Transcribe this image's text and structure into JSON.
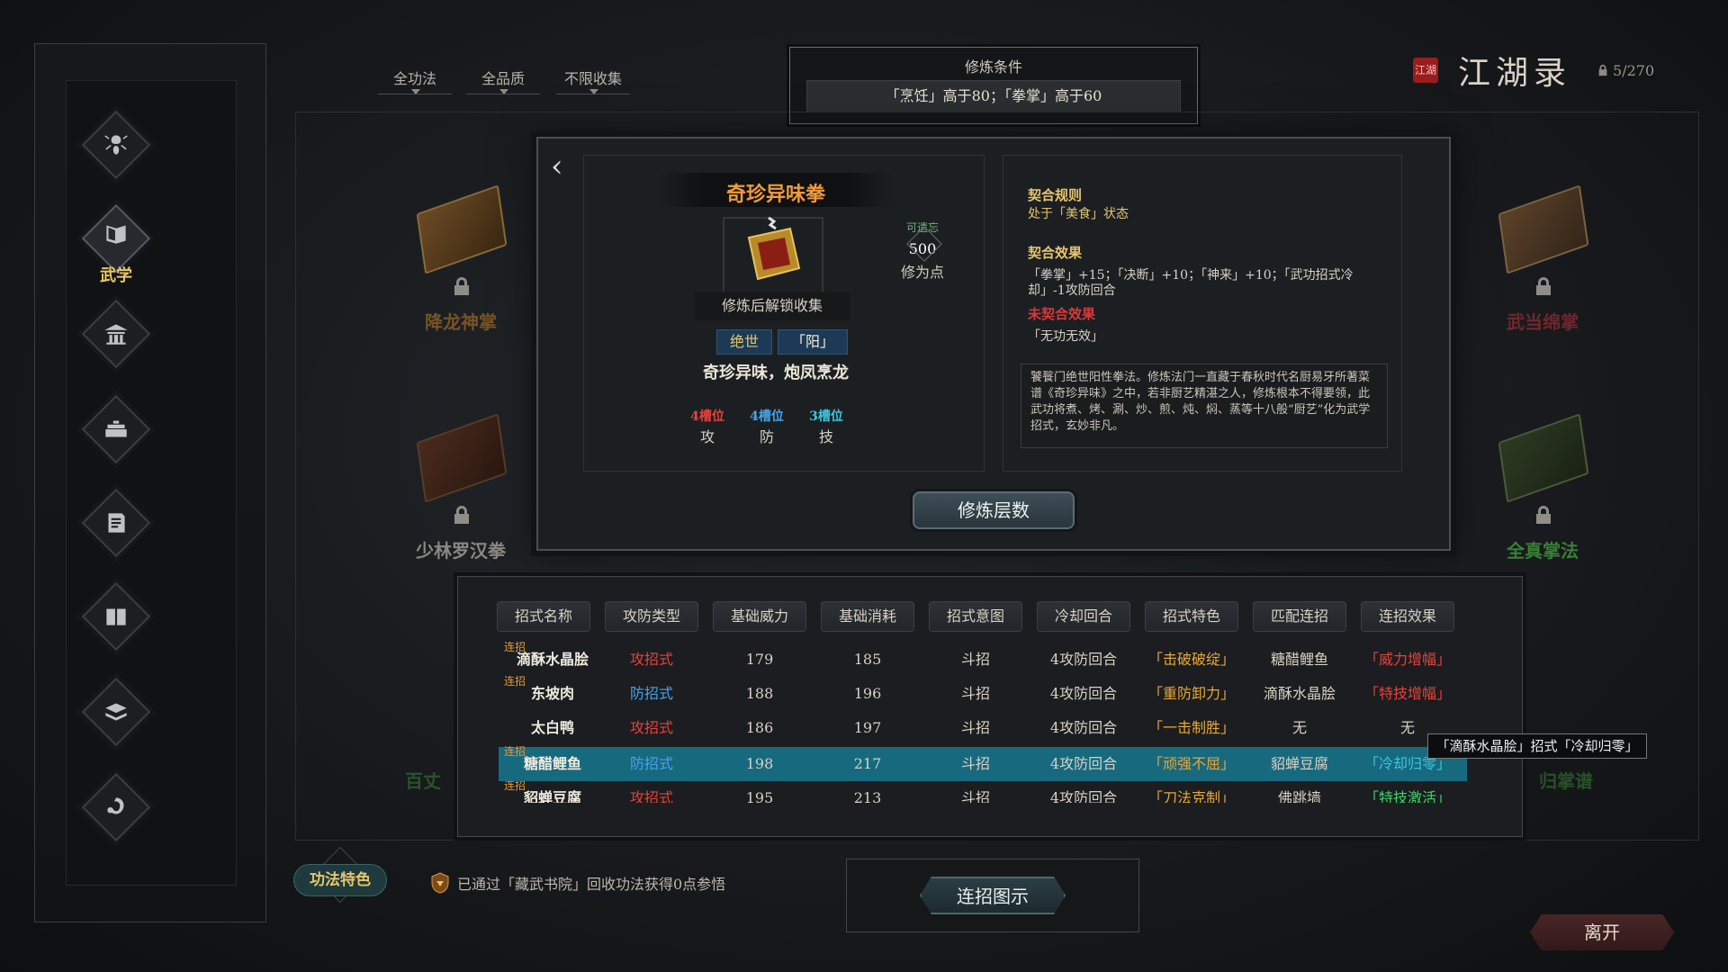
{
  "filters": [
    {
      "label": "全功法"
    },
    {
      "label": "全品质"
    },
    {
      "label": "不限收集"
    }
  ],
  "condition": {
    "title": "修炼条件",
    "value": "「烹饪」高于80；「拳掌」高于60"
  },
  "header": {
    "seal": "江湖",
    "title": "江湖录",
    "count": "5/270"
  },
  "sidebar": {
    "items": [
      {
        "icon": "scorpion-icon"
      },
      {
        "icon": "martial-book-icon",
        "label": "武学"
      },
      {
        "icon": "pavilion-icon"
      },
      {
        "icon": "treasure-icon"
      },
      {
        "icon": "manual-icon"
      },
      {
        "icon": "book-icon"
      },
      {
        "icon": "stack-books-icon"
      },
      {
        "icon": "dragon-icon"
      }
    ]
  },
  "books": [
    {
      "name": "降龙神掌",
      "color": "#c27e2a"
    },
    {
      "name": "少林罗汉拳",
      "color": "#b9b4a8"
    },
    {
      "name": "武当绵掌",
      "color": "#b8323a"
    },
    {
      "name": "全真掌法",
      "color": "#3f9a3a"
    },
    {
      "name": "百丈",
      "color": "#3f9a3a"
    },
    {
      "name": "归掌谱",
      "color": "#3f9a3a"
    }
  ],
  "kungfu": {
    "name": "奇珍异味拳",
    "unlock": "修炼后解锁收集",
    "tag1": "绝世",
    "tag2": "「阳」",
    "motto": "奇珍异味，炮凤烹龙",
    "forget": {
      "label": "可遗忘",
      "value": "500",
      "unit": "修为点"
    },
    "slots": [
      {
        "num": "4槽位",
        "kind": "攻",
        "color": "#e8423a"
      },
      {
        "num": "4槽位",
        "kind": "防",
        "color": "#4aa3e8"
      },
      {
        "num": "3槽位",
        "kind": "技",
        "color": "#3dc6e0"
      }
    ]
  },
  "rules": {
    "h1": "契合规则",
    "t1": "处于「美食」状态",
    "h2": "契合效果",
    "t2": "「拳掌」+15；「决断」+10；「神来」+10；「武功招式冷却」-1攻防回合",
    "h3": "未契合效果",
    "t3": "「无功无效」",
    "desc": "饕餮门绝世阳性拳法。修炼法门一直藏于春秋时代名厨易牙所著菜谱《奇珍异味》之中，若非厨艺精湛之人，修炼根本不得要领，此武功将煮、烤、涮、炒、煎、炖、焖、蒸等十八般“厨艺”化为武学招式，玄妙非凡。"
  },
  "cultivate_btn": "修炼层数",
  "table": {
    "headers": [
      "招式名称",
      "攻防类型",
      "基础威力",
      "基础消耗",
      "招式意图",
      "冷却回合",
      "招式特色",
      "匹配连招",
      "连招效果"
    ],
    "lian": "连招",
    "rows": [
      {
        "name": "滴酥水晶脍",
        "type": "攻招式",
        "power": "179",
        "cost": "185",
        "intent": "斗招",
        "cd": "4攻防回合",
        "feat": "「击破破绽」",
        "match": "糖醋鲤鱼",
        "effect": "「威力增幅」",
        "lian": true
      },
      {
        "name": "东坡肉",
        "type": "防招式",
        "power": "188",
        "cost": "196",
        "intent": "斗招",
        "cd": "4攻防回合",
        "feat": "「重防卸力」",
        "match": "滴酥水晶脍",
        "effect": "「特技增幅」",
        "lian": true
      },
      {
        "name": "太白鸭",
        "type": "攻招式",
        "power": "186",
        "cost": "197",
        "intent": "斗招",
        "cd": "4攻防回合",
        "feat": "「一击制胜」",
        "match": "无",
        "effect": "无",
        "lian": false
      },
      {
        "name": "糖醋鲤鱼",
        "type": "防招式",
        "power": "198",
        "cost": "217",
        "intent": "斗招",
        "cd": "4攻防回合",
        "feat": "「顽强不屈」",
        "match": "貂蝉豆腐",
        "effect": "「冷却归零」",
        "lian": true
      },
      {
        "name": "貂蝉豆腐",
        "type": "攻招式",
        "power": "195",
        "cost": "213",
        "intent": "斗招",
        "cd": "4攻防回合",
        "feat": "「刀法克制」",
        "match": "佛跳墙",
        "effect": "「特技激活」",
        "lian": true
      }
    ]
  },
  "tooltip": "「滴酥水晶脍」招式「冷却归零」",
  "feature_btn": "功法特色",
  "notice": "已通过「藏武书院」回收功法获得0点参悟",
  "combo_btn": "连招图示",
  "leave_btn": "离开",
  "colors": {
    "attack": "#e8423a",
    "defense": "#4aa3e8",
    "feat": "#e8a83a",
    "effect_red": "#e8423a",
    "effect_green": "#3dd66a",
    "effect_cyan": "#3dc6e0",
    "gold": "#e6c66e",
    "selected": "#17697e"
  }
}
